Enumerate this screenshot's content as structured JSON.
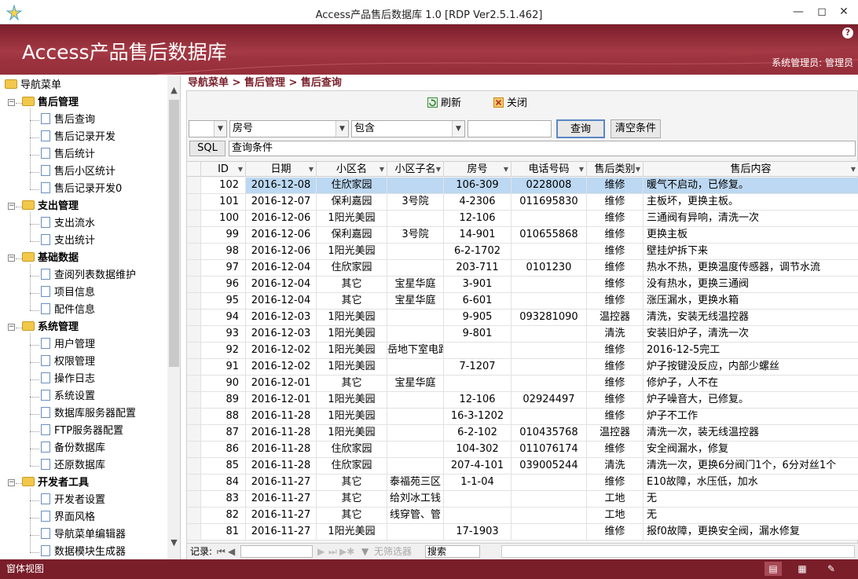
{
  "window": {
    "title": "Access产品售后数据库 1.0 [RDP Ver2.5.1.462]"
  },
  "banner": {
    "title": "Access产品售后数据库",
    "user": "系统管理员: 管理员"
  },
  "sidebar": {
    "root": "导航菜单",
    "groups": [
      {
        "label": "售后管理",
        "items": [
          "售后查询",
          "售后记录开发",
          "售后统计",
          "售后小区统计",
          "售后记录开发0"
        ]
      },
      {
        "label": "支出管理",
        "items": [
          "支出流水",
          "支出统计"
        ]
      },
      {
        "label": "基础数据",
        "items": [
          "查阅列表数据维护",
          "项目信息",
          "配件信息"
        ]
      },
      {
        "label": "系统管理",
        "items": [
          "用户管理",
          "权限管理",
          "操作日志",
          "系统设置",
          "数据库服务器配置",
          "FTP服务器配置",
          "备份数据库",
          "还原数据库"
        ]
      },
      {
        "label": "开发者工具",
        "items": [
          "开发者设置",
          "界面风格",
          "导航菜单编辑器",
          "数据模块生成器"
        ]
      }
    ]
  },
  "breadcrumb": "导航菜单 > 售后管理 > 售后查询",
  "toolbar": {
    "refresh": "刷新",
    "close": "关闭"
  },
  "filter": {
    "logic": "",
    "field": "房号",
    "operator": "包含",
    "value": "",
    "query_label": "查询",
    "clear_label": "清空条件",
    "sql_label": "SQL",
    "condition_label": "查询条件"
  },
  "columns": [
    "ID",
    "日期",
    "小区名",
    "小区子名",
    "房号",
    "电话号码",
    "售后类别",
    "售后内容"
  ],
  "rows": [
    [
      "102",
      "2016-12-08",
      "住欣家园",
      "",
      "106-309",
      "0228008",
      "维修",
      "暖气不启动，已修复。"
    ],
    [
      "101",
      "2016-12-07",
      "保利嘉园",
      "3号院",
      "4-2306",
      "011695830",
      "维修",
      "主板坏，更换主板。"
    ],
    [
      "100",
      "2016-12-06",
      "1阳光美园",
      "",
      "12-106",
      "",
      "维修",
      "三通阀有异响，清洗一次"
    ],
    [
      "99",
      "2016-12-06",
      "保利嘉园",
      "3号院",
      "14-901",
      "010655868",
      "维修",
      "更换主板"
    ],
    [
      "98",
      "2016-12-06",
      "1阳光美园",
      "",
      "6-2-1702",
      "",
      "维修",
      "壁挂炉拆下来"
    ],
    [
      "97",
      "2016-12-04",
      "住欣家园",
      "",
      "203-711",
      "0101230",
      "维修",
      "热水不热，更换温度传感器，调节水流"
    ],
    [
      "96",
      "2016-12-04",
      "其它",
      "宝星华庭",
      "3-901",
      "",
      "维修",
      "没有热水，更换三通阀"
    ],
    [
      "95",
      "2016-12-04",
      "其它",
      "宝星华庭",
      "6-601",
      "",
      "维修",
      "涨压漏水，更换水箱"
    ],
    [
      "94",
      "2016-12-03",
      "1阳光美园",
      "",
      "9-905",
      "093281090",
      "温控器",
      "清洗，安装无线温控器"
    ],
    [
      "93",
      "2016-12-03",
      "1阳光美园",
      "",
      "9-801",
      "",
      "清洗",
      "安装旧炉子，清洗一次"
    ],
    [
      "92",
      "2016-12-02",
      "1阳光美园",
      "岳地下室电路",
      "",
      "",
      "维修",
      "2016-12-5完工"
    ],
    [
      "91",
      "2016-12-02",
      "1阳光美园",
      "",
      "7-1207",
      "",
      "维修",
      "炉子按键没反应，内部少螺丝"
    ],
    [
      "90",
      "2016-12-01",
      "其它",
      "宝星华庭",
      "",
      "",
      "维修",
      "修炉子，人不在"
    ],
    [
      "89",
      "2016-12-01",
      "1阳光美园",
      "",
      "12-106",
      "02924497",
      "维修",
      "炉子噪音大，已修复。"
    ],
    [
      "88",
      "2016-11-28",
      "1阳光美园",
      "",
      "16-3-1202",
      "",
      "维修",
      "炉子不工作"
    ],
    [
      "87",
      "2016-11-28",
      "1阳光美园",
      "",
      "6-2-102",
      "010435768",
      "温控器",
      "清洗一次，装无线温控器"
    ],
    [
      "86",
      "2016-11-28",
      "住欣家园",
      "",
      "104-302",
      "011076174",
      "维修",
      "安全阀漏水，修复"
    ],
    [
      "85",
      "2016-11-28",
      "住欣家园",
      "",
      "207-4-101",
      "039005244",
      "清洗",
      "清洗一次，更换6分阀门1个，6分对丝1个"
    ],
    [
      "84",
      "2016-11-27",
      "其它",
      "泰福苑三区",
      "1-1-04",
      "",
      "维修",
      "E10故障，水压低，加水"
    ],
    [
      "83",
      "2016-11-27",
      "其它",
      "给刘冰工钱",
      "",
      "",
      "工地",
      "无"
    ],
    [
      "82",
      "2016-11-27",
      "其它",
      "线穿管、管",
      "",
      "",
      "工地",
      "无"
    ],
    [
      "81",
      "2016-11-27",
      "1阳光美园",
      "",
      "17-1903",
      "",
      "维修",
      "报f0故障，更换安全阀，漏水修复"
    ]
  ],
  "footer": {
    "record_label": "记录:",
    "nofilter": "无筛选器",
    "search": "搜索"
  },
  "statusbar": {
    "view": "窗体视图"
  },
  "colors": {
    "banner": "#8a2632",
    "statusbar": "#7a1e2a",
    "selected_row": "#bcd8f2"
  }
}
